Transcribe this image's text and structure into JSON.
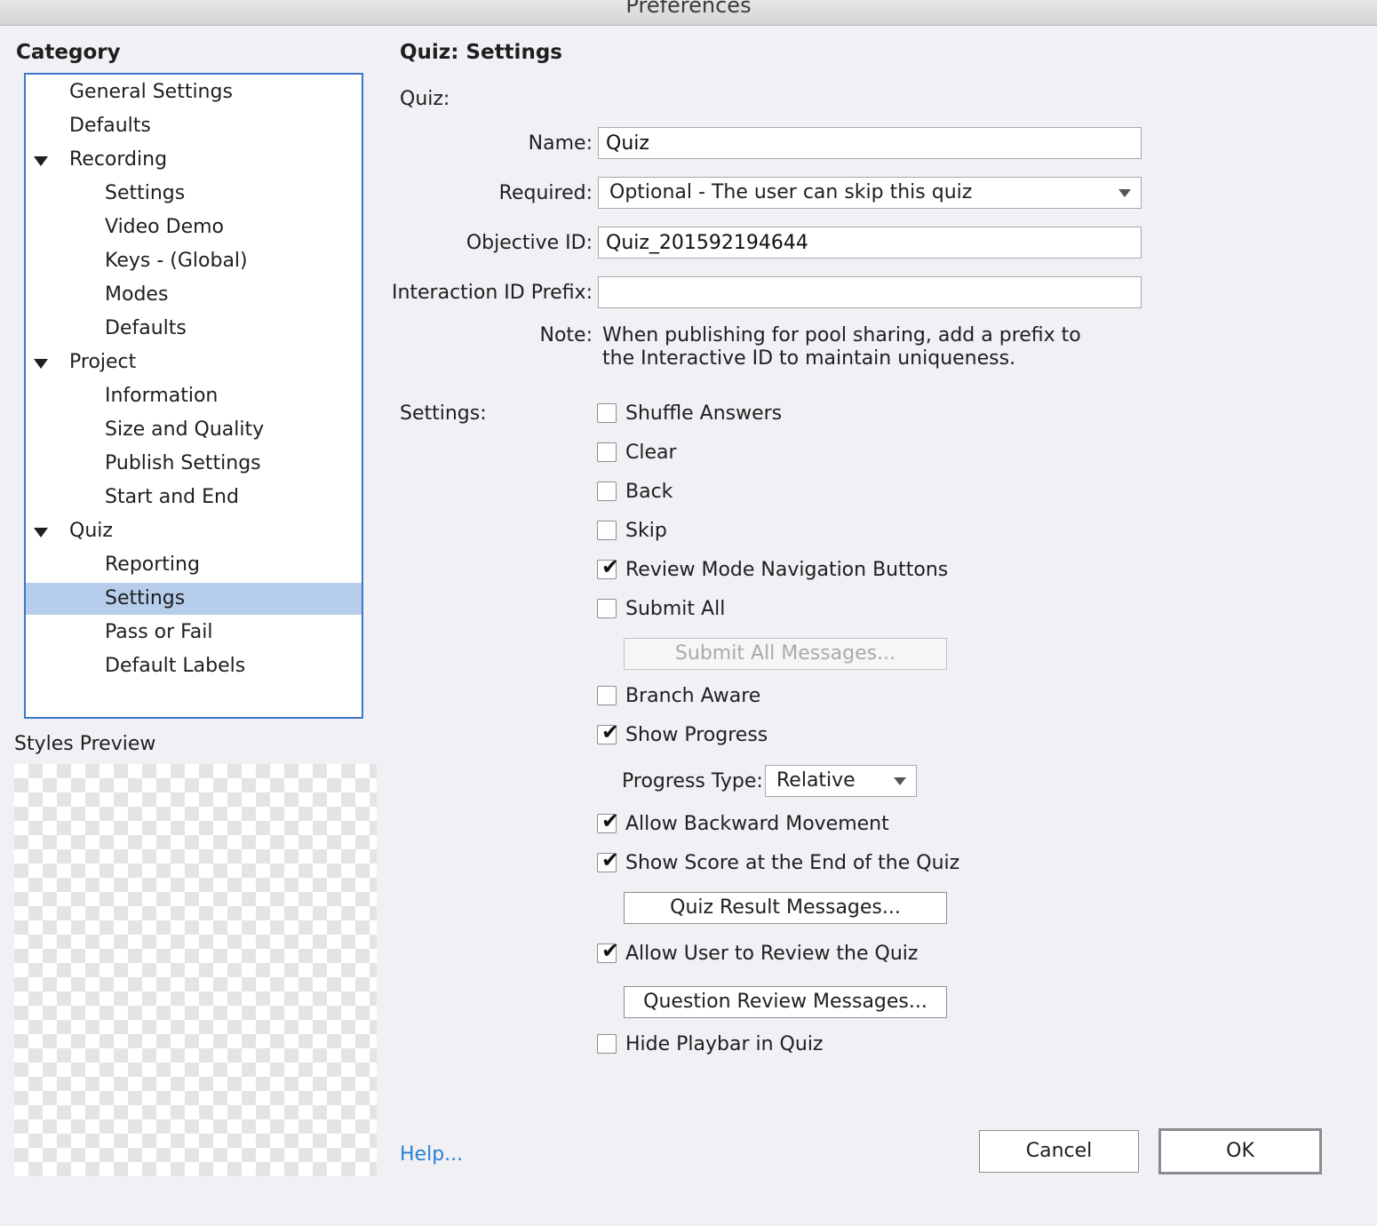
{
  "window": {
    "title": "Preferences"
  },
  "sidebar": {
    "heading": "Category",
    "items": [
      {
        "label": "General Settings"
      },
      {
        "label": "Defaults"
      },
      {
        "label": "Recording"
      },
      {
        "label": "Settings"
      },
      {
        "label": "Video Demo"
      },
      {
        "label": "Keys - (Global)"
      },
      {
        "label": "Modes"
      },
      {
        "label": "Defaults"
      },
      {
        "label": "Project"
      },
      {
        "label": "Information"
      },
      {
        "label": "Size and Quality"
      },
      {
        "label": "Publish Settings"
      },
      {
        "label": "Start and End"
      },
      {
        "label": "Quiz"
      },
      {
        "label": "Reporting"
      },
      {
        "label": "Settings",
        "selected": true
      },
      {
        "label": "Pass or Fail"
      },
      {
        "label": "Default Labels"
      }
    ],
    "styles_preview_label": "Styles Preview"
  },
  "main": {
    "title": "Quiz: Settings",
    "quiz_section_label": "Quiz:",
    "name": {
      "label": "Name:",
      "value": "Quiz"
    },
    "required": {
      "label": "Required:",
      "value": "Optional - The user can skip this quiz"
    },
    "objective_id": {
      "label": "Objective ID:",
      "value": "Quiz_201592194644"
    },
    "interaction_prefix": {
      "label": "Interaction ID Prefix:",
      "value": ""
    },
    "note": {
      "label": "Note:",
      "line1": "When publishing for pool sharing, add a prefix to",
      "line2": "the Interactive ID to maintain uniqueness."
    },
    "settings_label": "Settings:",
    "checkboxes": {
      "shuffle_answers": {
        "label": "Shuffle Answers",
        "checked": false
      },
      "clear": {
        "label": "Clear",
        "checked": false
      },
      "back": {
        "label": "Back",
        "checked": false
      },
      "skip": {
        "label": "Skip",
        "checked": false
      },
      "review_mode_nav": {
        "label": "Review Mode Navigation Buttons",
        "checked": true
      },
      "submit_all": {
        "label": "Submit All",
        "checked": false
      },
      "branch_aware": {
        "label": "Branch Aware",
        "checked": false
      },
      "show_progress": {
        "label": "Show Progress",
        "checked": true
      },
      "allow_backward": {
        "label": "Allow Backward Movement",
        "checked": true
      },
      "show_score": {
        "label": "Show Score at the End of the Quiz",
        "checked": true
      },
      "allow_review": {
        "label": "Allow User to Review the Quiz",
        "checked": true
      },
      "hide_playbar": {
        "label": "Hide Playbar in Quiz",
        "checked": false
      }
    },
    "submit_all_messages_button": "Submit All Messages...",
    "progress_type": {
      "label": "Progress Type:",
      "value": "Relative"
    },
    "quiz_result_messages_button": "Quiz Result Messages...",
    "question_review_messages_button": "Question Review Messages..."
  },
  "footer": {
    "help_link": "Help...",
    "cancel_button": "Cancel",
    "ok_button": "OK"
  },
  "colors": {
    "selection": "#b7cdec",
    "tree_border": "#3b78c9",
    "link": "#2a7fd4",
    "background": "#f0f0f5"
  }
}
